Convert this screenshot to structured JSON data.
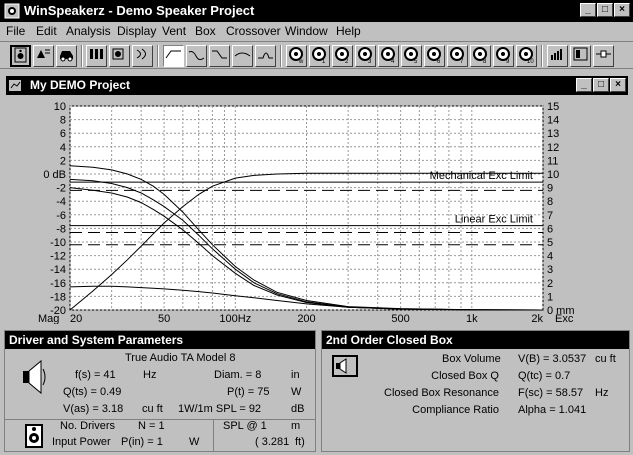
{
  "app": {
    "title": "WinSpeakerz - Demo Speaker Project",
    "window_buttons": [
      "_",
      "□",
      "×"
    ]
  },
  "menu": [
    "File",
    "Edit",
    "Analysis",
    "Display",
    "Vent",
    "Box",
    "Crossover",
    "Window",
    "Help"
  ],
  "toolbar": {
    "buttons": [
      "speaker-icon",
      "driver-edit-icon",
      "car-icon",
      "sealed-box-icon",
      "ported-icon",
      "crossover-icon",
      "line-flat-icon",
      "line-bump-icon",
      "line-rolloff-icon",
      "line-dip-icon",
      "line-peak-icon",
      "driver-w-icon",
      "driver-1-icon",
      "driver-2-icon",
      "driver-3-icon",
      "driver-4-icon",
      "driver-5-icon",
      "driver-6-icon",
      "driver-7-icon",
      "driver-8-icon",
      "driver-9-icon",
      "driver-10-icon",
      "bars-icon",
      "box-layout-icon",
      "connector-icon"
    ],
    "driver_labels": [
      "w",
      "1",
      "2",
      "3",
      "4",
      "5",
      "6",
      "7",
      "8",
      "9",
      "10"
    ]
  },
  "graph_window": {
    "title": "My DEMO Project",
    "window_buttons": [
      "_",
      "□",
      "×"
    ]
  },
  "chart_data": {
    "type": "line",
    "left_axis": {
      "ticks": [
        "10",
        "8",
        "6",
        "4",
        "2",
        "0 dB",
        "-2",
        "-4",
        "-6",
        "-8",
        "-10",
        "-12",
        "-14",
        "-16",
        "-18",
        "-20"
      ],
      "values": [
        10,
        8,
        6,
        4,
        2,
        0,
        -2,
        -4,
        -6,
        -8,
        -10,
        -12,
        -14,
        -16,
        -18,
        -20
      ],
      "range": [
        -20,
        10
      ],
      "bottom_label": "Mag"
    },
    "right_axis": {
      "ticks": [
        "15",
        "14",
        "13",
        "12",
        "11",
        "10",
        "9",
        "8",
        "7",
        "6",
        "5",
        "4",
        "3",
        "2",
        "1",
        "0 mm"
      ],
      "values": [
        15,
        14,
        13,
        12,
        11,
        10,
        9,
        8,
        7,
        6,
        5,
        4,
        3,
        2,
        1,
        0
      ],
      "range": [
        0,
        15
      ],
      "bottom_label": "Exc"
    },
    "x_axis": {
      "scale": "log",
      "range": [
        20,
        2000
      ],
      "tick_labels": [
        {
          "value": 20,
          "label": "20"
        },
        {
          "value": 50,
          "label": "50"
        },
        {
          "value": 100,
          "label": "100Hz"
        },
        {
          "value": 200,
          "label": "200"
        },
        {
          "value": 500,
          "label": "500"
        },
        {
          "value": 1000,
          "label": "1k"
        },
        {
          "value": 2000,
          "label": "2k"
        }
      ],
      "gridlines": [
        20,
        30,
        40,
        50,
        60,
        70,
        80,
        90,
        100,
        200,
        300,
        400,
        500,
        600,
        700,
        800,
        900,
        1000,
        2000
      ]
    },
    "grid": true,
    "reference_lines": [
      {
        "label": "Mechanical Exc Limit",
        "value_mm": 9.4,
        "style": "solid"
      },
      {
        "label": "",
        "value_mm": 8.8,
        "style": "dashed"
      },
      {
        "label": "Linear Exc Limit",
        "value_mm": 6.2,
        "style": "solid"
      },
      {
        "label": "",
        "value_mm": 5.7,
        "style": "dashed"
      },
      {
        "label": "",
        "value_mm": 4.8,
        "style": "dashed"
      }
    ],
    "series": [
      {
        "axis": "left",
        "x": [
          20,
          25,
          30,
          35,
          40,
          45,
          50,
          60,
          70,
          80,
          100,
          120,
          150,
          200,
          300,
          500,
          1000,
          2000
        ],
        "values": [
          -20,
          -17.2,
          -14.8,
          -12.6,
          -10.6,
          -8.8,
          -7.2,
          -4.8,
          -3.0,
          -1.8,
          -0.6,
          -0.2,
          0,
          0.1,
          0.1,
          0.1,
          0.1,
          0.1
        ]
      },
      {
        "axis": "right",
        "x": [
          20,
          25,
          30,
          35,
          40,
          45,
          50,
          60,
          70,
          80,
          100,
          120,
          150,
          200,
          300,
          500,
          1000,
          2000
        ],
        "values": [
          10.6,
          10.5,
          10.3,
          10.0,
          9.6,
          9.1,
          8.5,
          7.2,
          5.9,
          4.8,
          3.2,
          2.2,
          1.3,
          0.7,
          0.25,
          0.1,
          0.02,
          0
        ]
      },
      {
        "axis": "right",
        "x": [
          20,
          25,
          30,
          35,
          40,
          45,
          50,
          60,
          70,
          80,
          100,
          120,
          150,
          200,
          300,
          500,
          1000,
          2000
        ],
        "values": [
          9.6,
          9.5,
          9.3,
          9.0,
          8.6,
          8.1,
          7.6,
          6.6,
          5.5,
          4.5,
          3.0,
          2.0,
          1.2,
          0.6,
          0.2,
          0.08,
          0.02,
          0
        ]
      },
      {
        "axis": "right",
        "x": [
          20,
          25,
          30,
          35,
          40,
          45,
          50,
          60,
          70,
          80,
          100,
          120,
          150,
          200,
          300,
          500,
          1000,
          2000
        ],
        "values": [
          9.0,
          8.8,
          8.6,
          8.3,
          7.9,
          7.4,
          6.9,
          5.9,
          4.9,
          4.0,
          2.7,
          1.8,
          1.1,
          0.55,
          0.2,
          0.07,
          0.02,
          0
        ]
      },
      {
        "axis": "right",
        "x": [
          20,
          25,
          30,
          35,
          40,
          45,
          50,
          60,
          70,
          80,
          100,
          120,
          150,
          200,
          300,
          500,
          1000,
          2000
        ],
        "values": [
          1.7,
          1.75,
          1.75,
          1.7,
          1.65,
          1.6,
          1.55,
          1.45,
          1.35,
          1.25,
          1.05,
          0.9,
          0.7,
          0.45,
          0.2,
          0.06,
          0.01,
          0
        ]
      }
    ]
  },
  "driver_panel": {
    "title": "Driver and System Parameters",
    "model": "True Audio  TA Model 8",
    "fs": "f(s) = 41",
    "fs_unit": "Hz",
    "qts": "Q(ts) = 0.49",
    "vas": "V(as) = 3.18",
    "vas_unit": "cu ft",
    "diam": "Diam. = 8",
    "diam_unit": "in",
    "pt": "P(t) = 75",
    "pt_unit": "W",
    "spl": "1W/1m SPL = 92",
    "spl_unit": "dB",
    "no_drivers_label": "No. Drivers",
    "no_drivers_value": "N = 1",
    "input_power_label": "Input Power",
    "input_power_value": "P(in) = 1",
    "input_power_unit": "W",
    "spl_at": "SPL @ 1",
    "spl_at_unit": "m",
    "spl_ft": "( 3.281",
    "spl_ft_unit": "ft)"
  },
  "box_panel": {
    "title": "2nd Order Closed Box",
    "rows": [
      {
        "label": "Box Volume",
        "value": "V(B) = 3.0537",
        "unit": "cu ft"
      },
      {
        "label": "Closed Box Q",
        "value": "Q(tc) = 0.7",
        "unit": ""
      },
      {
        "label": "Closed Box Resonance",
        "value": "F(sc) = 58.57",
        "unit": "Hz"
      },
      {
        "label": "Compliance Ratio",
        "value": "Alpha = 1.041",
        "unit": ""
      }
    ]
  }
}
